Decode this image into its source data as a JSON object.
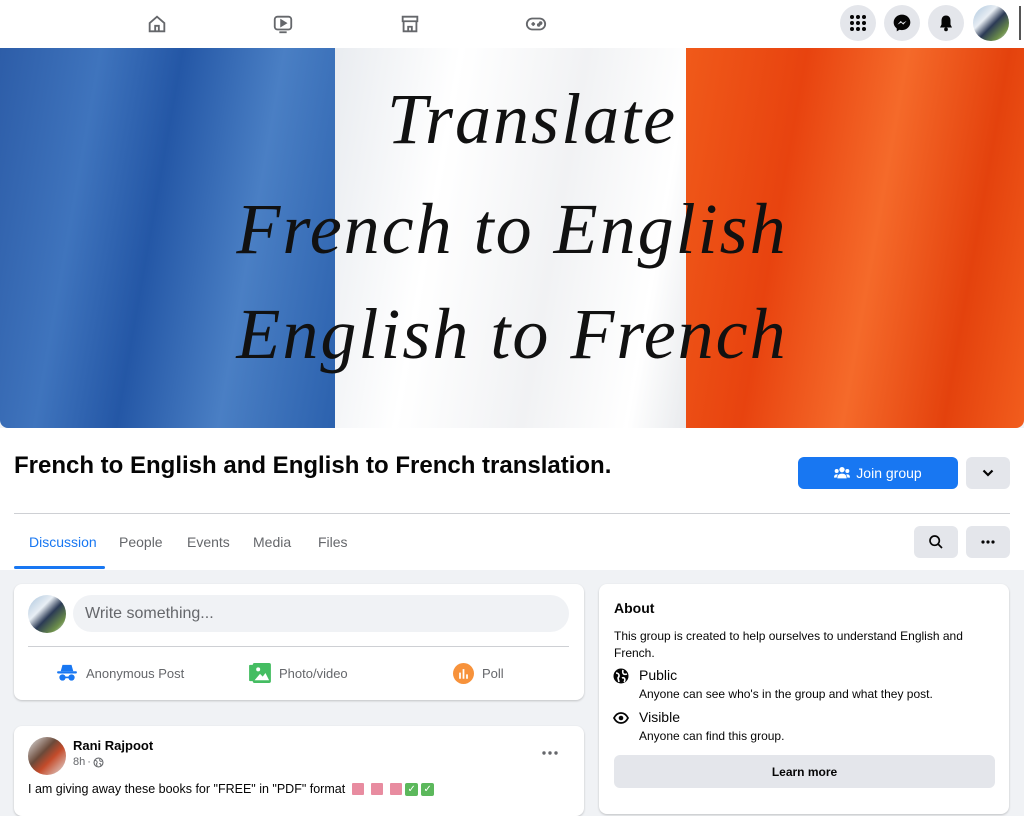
{
  "topbar": {
    "nav": [
      {
        "name": "home",
        "icon": "home-icon"
      },
      {
        "name": "watch",
        "icon": "video-icon"
      },
      {
        "name": "marketplace",
        "icon": "store-icon"
      },
      {
        "name": "gaming",
        "icon": "gamepad-icon"
      }
    ],
    "actions": [
      {
        "name": "menu",
        "icon": "grid-menu-icon"
      },
      {
        "name": "messenger",
        "icon": "messenger-icon"
      },
      {
        "name": "notifications",
        "icon": "bell-icon"
      }
    ]
  },
  "banner": {
    "line1": "Translate",
    "line2": "French to English",
    "line3": "English to French",
    "colors": {
      "blue": "#2d5da8",
      "white": "#ffffff",
      "red": "#e8430f"
    }
  },
  "group": {
    "title": "French to English and English to French translation.",
    "join_label": "Join group",
    "accent": "#1877f2"
  },
  "tabs": [
    {
      "label": "Discussion",
      "active": true
    },
    {
      "label": "People",
      "active": false
    },
    {
      "label": "Events",
      "active": false
    },
    {
      "label": "Media",
      "active": false
    },
    {
      "label": "Files",
      "active": false
    }
  ],
  "composer": {
    "placeholder": "Write something...",
    "actions": [
      {
        "label": "Anonymous Post",
        "icon": "anonymous-icon",
        "color": "#1877f2"
      },
      {
        "label": "Photo/video",
        "icon": "photo-icon",
        "color": "#45bd62"
      },
      {
        "label": "Poll",
        "icon": "poll-icon",
        "color": "#f7923b"
      }
    ]
  },
  "post": {
    "author": "Rani Rajpoot",
    "time": "8h",
    "separator": "·",
    "privacy": "public",
    "text": "I am giving away these books for \"FREE\" in \"PDF\" format"
  },
  "about": {
    "title": "About",
    "description": "This group is created to help ourselves to understand English and French.",
    "rows": [
      {
        "title": "Public",
        "subtitle": "Anyone can see who's in the group and what they post.",
        "icon": "globe-icon"
      },
      {
        "title": "Visible",
        "subtitle": "Anyone can find this group.",
        "icon": "eye-icon"
      }
    ],
    "learn_more": "Learn more"
  }
}
